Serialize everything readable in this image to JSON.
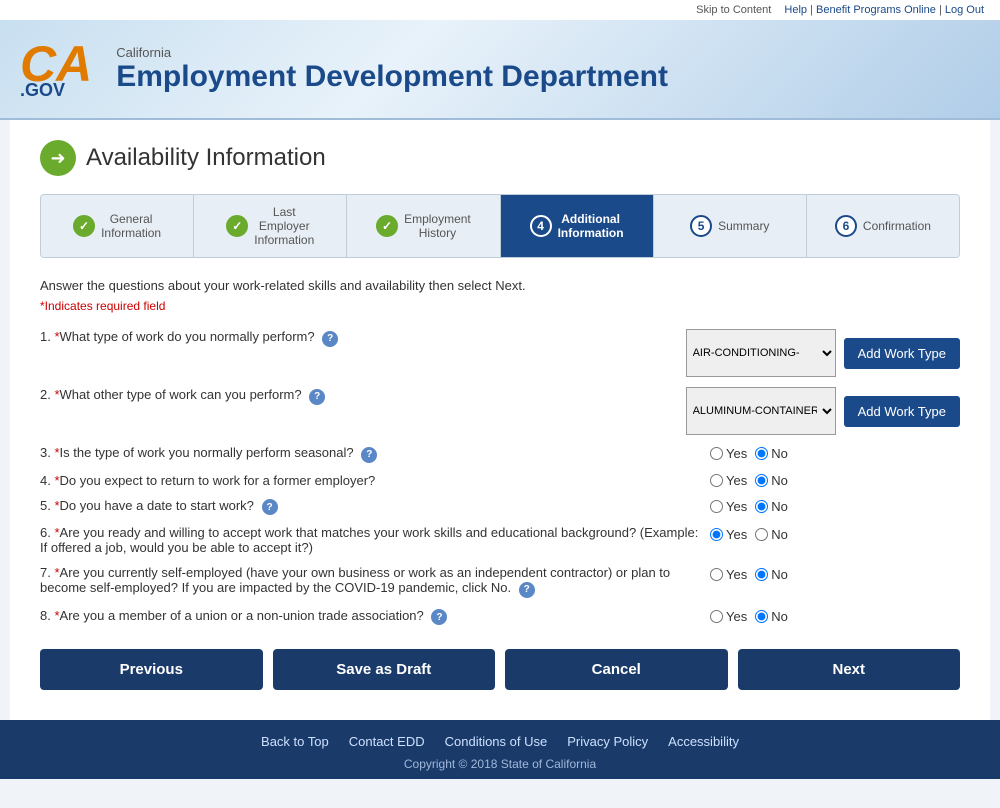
{
  "meta": {
    "skip_link": "Skip to Content",
    "help_link": "Help",
    "benefit_link": "Benefit Programs Online",
    "logout_link": "Log Out"
  },
  "header": {
    "california": "California",
    "dept_name": "Employment Development Department",
    "logo_ca": "CA",
    "logo_gov": ".GOV"
  },
  "page": {
    "title": "Availability Information"
  },
  "steps": [
    {
      "id": 1,
      "label": "General Information",
      "status": "completed"
    },
    {
      "id": 2,
      "label": "Last Employer Information",
      "status": "completed"
    },
    {
      "id": 3,
      "label": "Employment History",
      "status": "completed"
    },
    {
      "id": 4,
      "label": "Additional Information",
      "status": "active"
    },
    {
      "id": 5,
      "label": "Summary",
      "status": "pending"
    },
    {
      "id": 6,
      "label": "Confirmation",
      "status": "pending"
    }
  ],
  "instructions": "Answer the questions about your work-related skills and availability then select Next.",
  "required_note": "*Indicates required field",
  "questions": [
    {
      "num": "1.",
      "text": "*What type of work do you normally perform?",
      "has_help": true,
      "type": "select_add",
      "select_value": "AIR-CONDITIONING-",
      "btn_label": "Add Work Type"
    },
    {
      "num": "2.",
      "text": "*What other type of work can you perform?",
      "has_help": true,
      "type": "select_add",
      "select_value": "ALUMINUM-CONTAINER",
      "btn_label": "Add Work Type"
    },
    {
      "num": "3.",
      "text": "*Is the type of work you normally perform seasonal?",
      "has_help": true,
      "type": "radio",
      "yes_checked": false,
      "no_checked": true
    },
    {
      "num": "4.",
      "text": "*Do you expect to return to work for a former employer?",
      "has_help": false,
      "type": "radio",
      "yes_checked": false,
      "no_checked": true
    },
    {
      "num": "5.",
      "text": "*Do you have a date to start work?",
      "has_help": true,
      "type": "radio",
      "yes_checked": false,
      "no_checked": true
    },
    {
      "num": "6.",
      "text": "*Are you ready and willing to accept work that matches your work skills and educational background? (Example: If offered a job, would you be able to accept it?)",
      "has_help": false,
      "type": "radio",
      "yes_checked": true,
      "no_checked": false
    },
    {
      "num": "7.",
      "text": "*Are you currently self-employed (have your own business or work as an independent contractor) or plan to become self-employed? If you are impacted by the COVID-19 pandemic, click No.",
      "has_help": true,
      "type": "radio",
      "yes_checked": false,
      "no_checked": true
    },
    {
      "num": "8.",
      "text": "*Are you a member of a union or a non-union trade association?",
      "has_help": true,
      "type": "radio",
      "yes_checked": false,
      "no_checked": true
    }
  ],
  "buttons": {
    "previous": "Previous",
    "save_draft": "Save as Draft",
    "cancel": "Cancel",
    "next": "Next"
  },
  "footer": {
    "back_to_top": "Back to Top",
    "contact_edd": "Contact EDD",
    "conditions": "Conditions of Use",
    "privacy": "Privacy Policy",
    "accessibility": "Accessibility",
    "copyright": "Copyright © 2018 State of California"
  }
}
